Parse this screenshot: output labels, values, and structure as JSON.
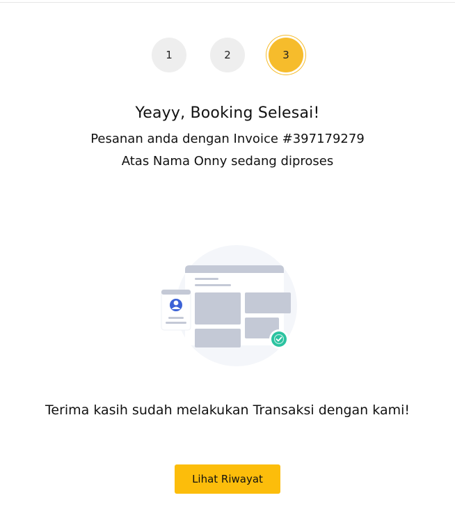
{
  "steps": [
    {
      "label": "1",
      "active": false
    },
    {
      "label": "2",
      "active": false
    },
    {
      "label": "3",
      "active": true
    }
  ],
  "colors": {
    "accent": "#f6bc2c",
    "button": "#fcbd0b",
    "step_inactive": "#eeeeee",
    "success": "#2bc3a0"
  },
  "confirmation": {
    "title": "Yeayy, Booking Selesai!",
    "line1": "Pesanan anda dengan Invoice #397179279",
    "line2": "Atas Nama Onny sedang diproses"
  },
  "illustration": {
    "icons": [
      "browser-window-icon",
      "user-profile-icon",
      "check-badge-icon"
    ]
  },
  "thanks_message": "Terima kasih sudah melakukan Transaksi dengan kami!",
  "actions": {
    "history_button": "Lihat Riwayat"
  }
}
